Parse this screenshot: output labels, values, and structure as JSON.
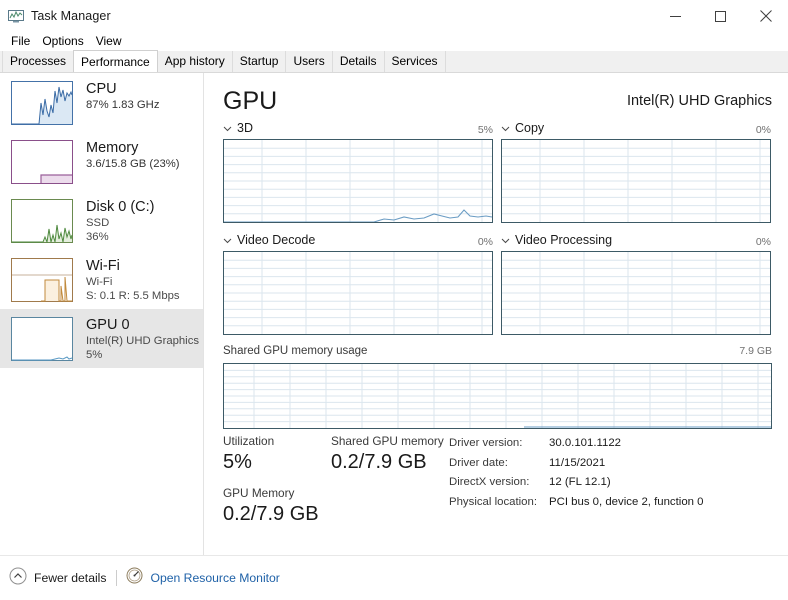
{
  "window": {
    "title": "Task Manager",
    "icon": "task-manager-icon",
    "buttons": {
      "minimize": "minimize-icon",
      "maximize": "maximize-icon",
      "close": "close-icon"
    }
  },
  "menu": {
    "items": [
      {
        "label": "File"
      },
      {
        "label": "Options"
      },
      {
        "label": "View"
      }
    ]
  },
  "tabs": {
    "active": "Performance",
    "items": [
      {
        "label": "Processes",
        "active": false
      },
      {
        "label": "Performance",
        "active": true
      },
      {
        "label": "App history",
        "active": false
      },
      {
        "label": "Startup",
        "active": false
      },
      {
        "label": "Users",
        "active": false
      },
      {
        "label": "Details",
        "active": false
      },
      {
        "label": "Services",
        "active": false
      }
    ]
  },
  "sidebar": {
    "items": [
      {
        "name": "cpu",
        "title": "CPU",
        "line1": "87%  1.83 GHz",
        "line2": "",
        "selected": false,
        "color": "#4472a8"
      },
      {
        "name": "memory",
        "title": "Memory",
        "line1": "3.6/15.8 GB (23%)",
        "line2": "",
        "selected": false,
        "color": "#8a4f8a"
      },
      {
        "name": "disk-0",
        "title": "Disk 0 (C:)",
        "line1": "SSD",
        "line2": "36%",
        "selected": false,
        "color": "#4f8a4f"
      },
      {
        "name": "wifi",
        "title": "Wi-Fi",
        "line1": "Wi-Fi",
        "line2": "S: 0.1 R: 5.5 Mbps",
        "selected": false,
        "color": "#b07a3c"
      },
      {
        "name": "gpu-0",
        "title": "GPU 0",
        "line1": "Intel(R) UHD Graphics",
        "line2": "5%",
        "selected": true,
        "color": "#3d7a9e"
      }
    ]
  },
  "main": {
    "title": "GPU",
    "device": "Intel(R) UHD Graphics",
    "engines": [
      {
        "label": "3D",
        "percent": "5%"
      },
      {
        "label": "Copy",
        "percent": "0%"
      },
      {
        "label": "Video Decode",
        "percent": "0%"
      },
      {
        "label": "Video Processing",
        "percent": "0%"
      }
    ],
    "memory_graph": {
      "label": "Shared GPU memory usage",
      "max": "7.9 GB"
    },
    "stats": {
      "utilization_key": "Utilization",
      "utilization_value": "5%",
      "shared_memory_key": "Shared GPU memory",
      "shared_memory_value": "0.2/7.9 GB",
      "gpu_memory_key": "GPU Memory",
      "gpu_memory_value": "0.2/7.9 GB"
    },
    "driver_info": [
      {
        "key": "Driver version:",
        "value": "30.0.101.1122"
      },
      {
        "key": "Driver date:",
        "value": "11/15/2021"
      },
      {
        "key": "DirectX version:",
        "value": "12 (FL 12.1)"
      },
      {
        "key": "Physical location:",
        "value": "PCI bus 0, device 2, function 0"
      }
    ]
  },
  "statusbar": {
    "fewer_details": "Fewer details",
    "resource_monitor": "Open Resource Monitor",
    "chevron_icon": "chevron-up-circle-icon",
    "monitor_icon": "resource-monitor-icon"
  },
  "colors": {
    "accent": "#2062a8",
    "graph_border": "#3d5a66",
    "graph_grid": "#dbe6ee",
    "selected_bg": "#e6e6e6"
  }
}
